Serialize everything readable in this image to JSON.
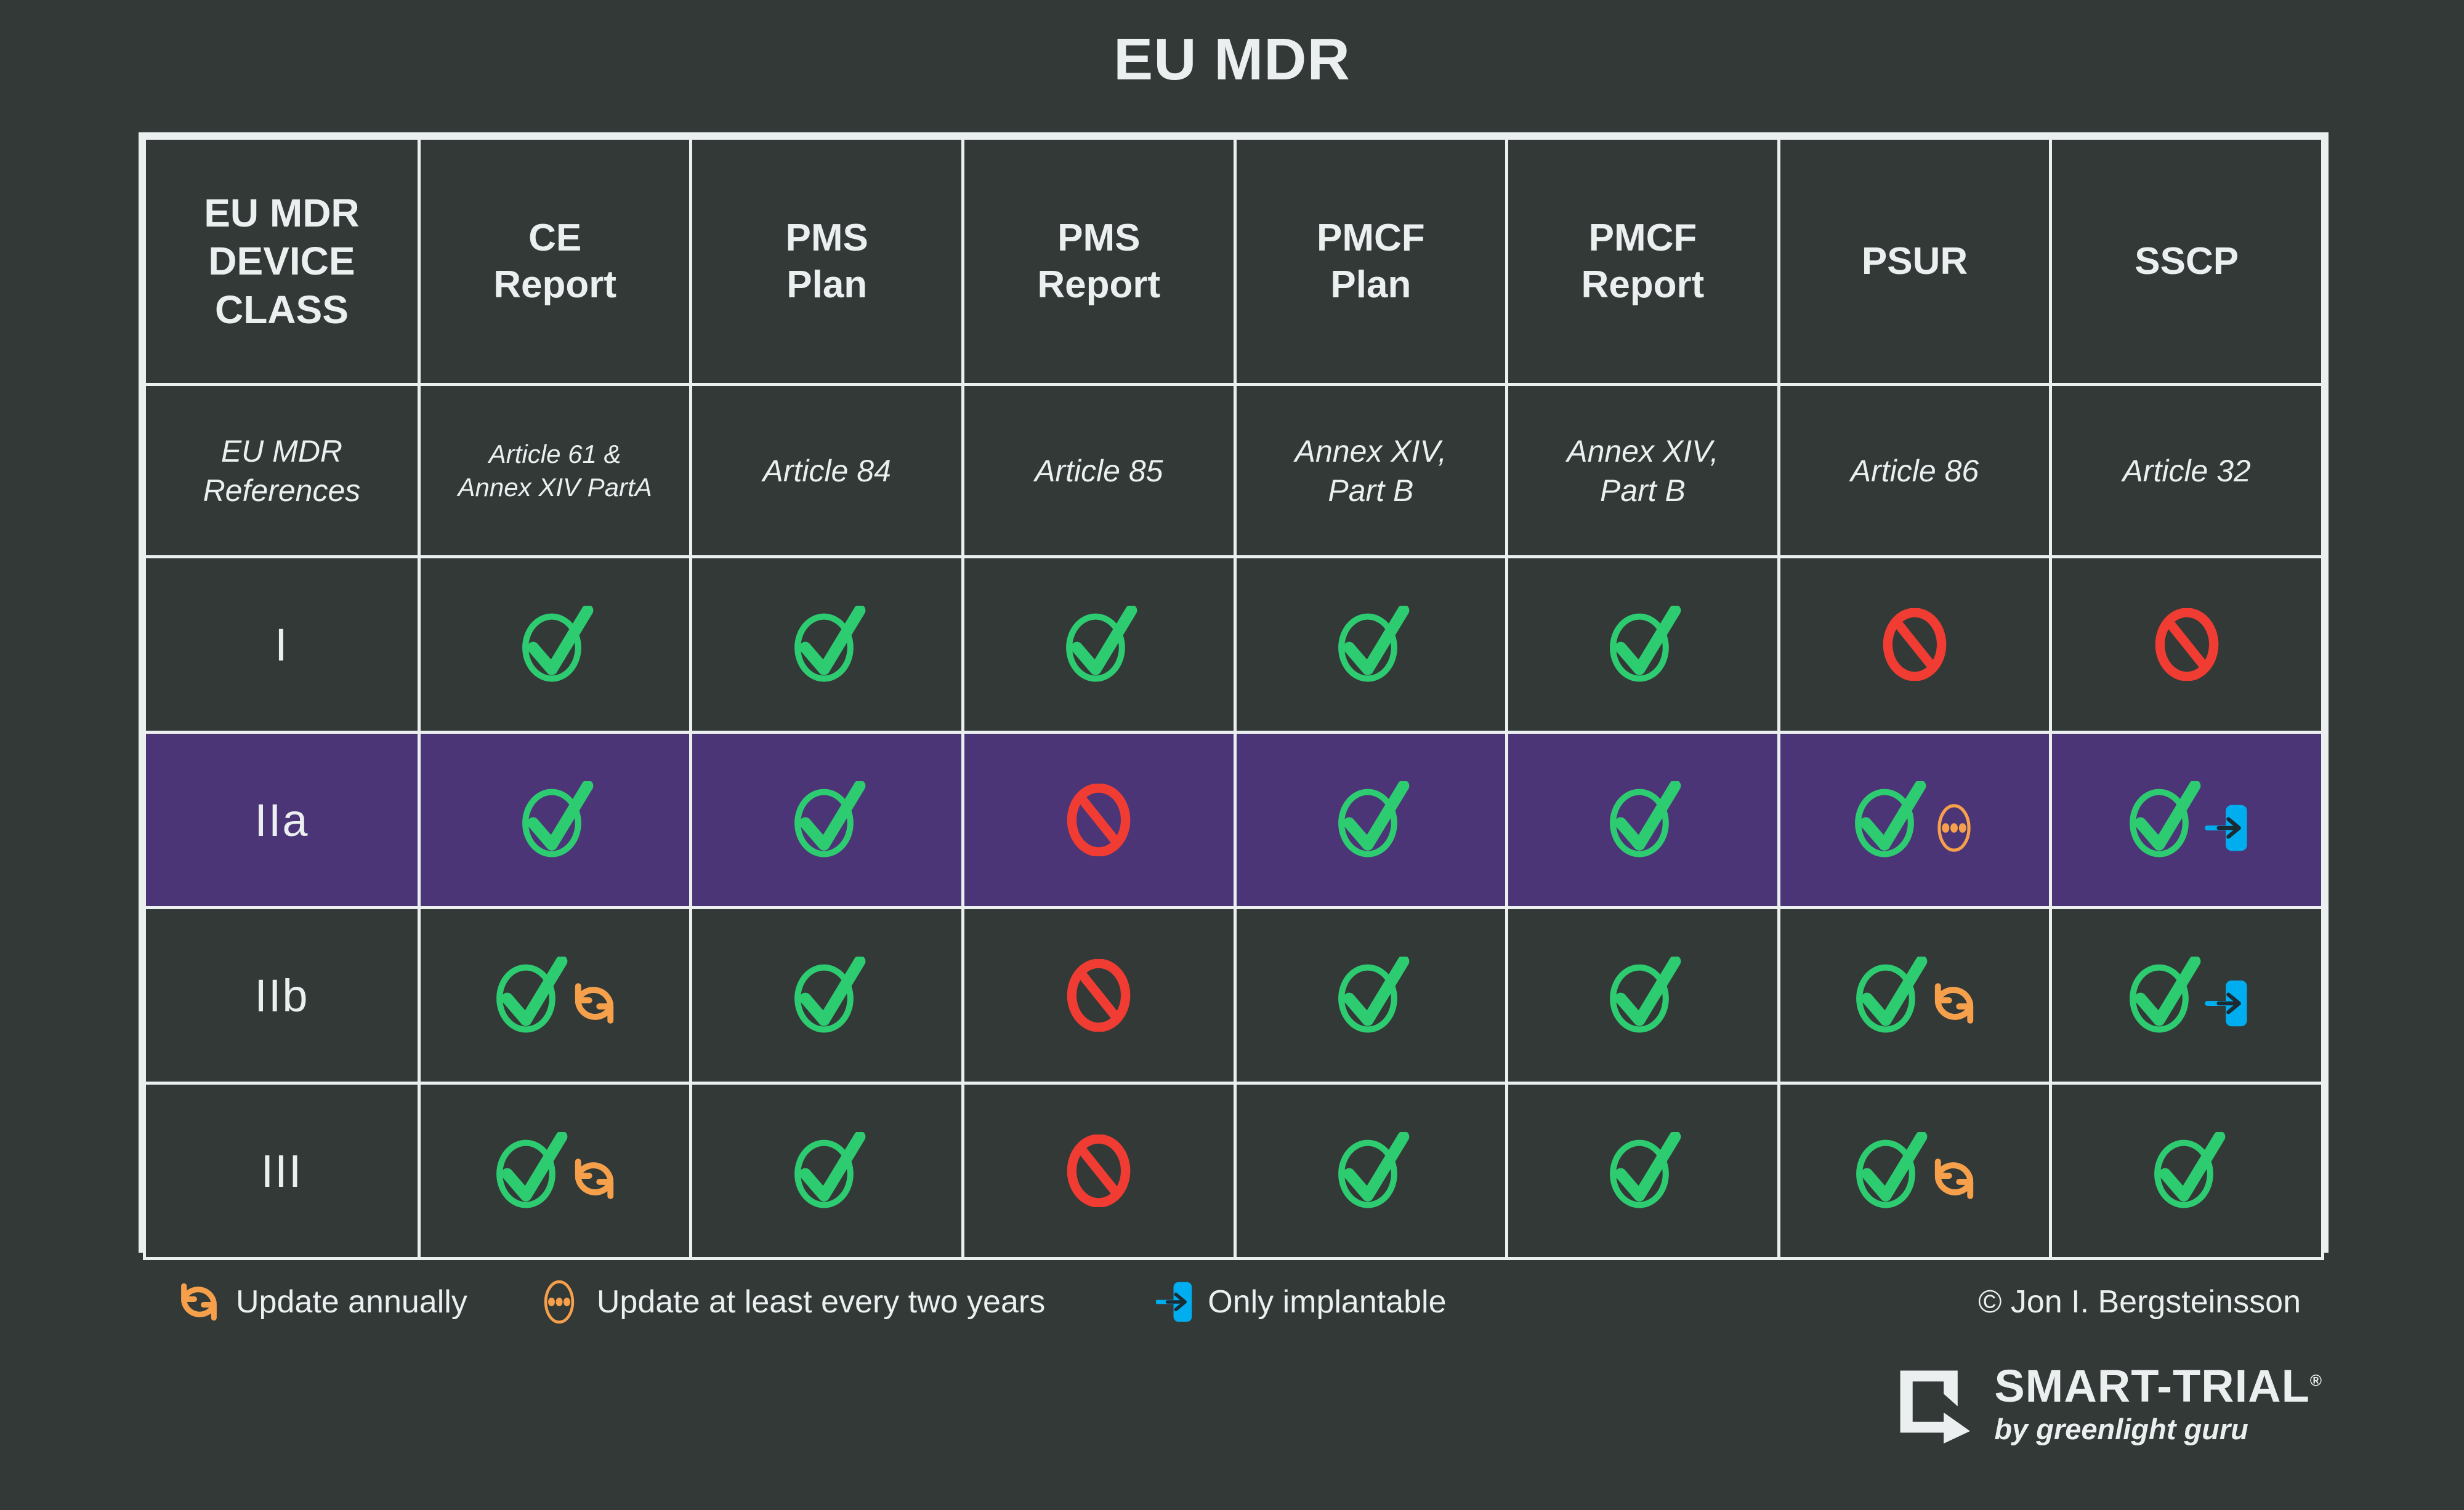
{
  "title": "EU MDR",
  "colors": {
    "background": "#323937",
    "grid": "#eceff0",
    "text": "#eceff0",
    "highlight_row": "#4b3576",
    "check_green": "#2ECC71",
    "deny_red": "#F03C32",
    "annual_orange": "#F7A04B",
    "implant_blue": "#00ADEF"
  },
  "table": {
    "headers": [
      {
        "label": "EU MDR\nDEVICE\nCLASS",
        "name": "col-device-class"
      },
      {
        "label": "CE\nReport",
        "name": "col-ce-report"
      },
      {
        "label": "PMS\nPlan",
        "name": "col-pms-plan"
      },
      {
        "label": "PMS\nReport",
        "name": "col-pms-report"
      },
      {
        "label": "PMCF\nPlan",
        "name": "col-pmcf-plan"
      },
      {
        "label": "PMCF\nReport",
        "name": "col-pmcf-report"
      },
      {
        "label": "PSUR",
        "name": "col-psur"
      },
      {
        "label": "SSCP",
        "name": "col-sscp"
      }
    ],
    "references": [
      "EU MDR\nReferences",
      "Article 61 &\nAnnex XIV PartA",
      "Article 84",
      "Article 85",
      "Annex XIV,\nPart B",
      "Annex XIV,\nPart B",
      "Article 86",
      "Article 32"
    ],
    "rows": [
      {
        "class": "I",
        "highlight": false,
        "cells": [
          {
            "status": "yes",
            "badge": null
          },
          {
            "status": "yes",
            "badge": null
          },
          {
            "status": "yes",
            "badge": null
          },
          {
            "status": "yes",
            "badge": null
          },
          {
            "status": "yes",
            "badge": null
          },
          {
            "status": "no",
            "badge": null
          },
          {
            "status": "no",
            "badge": null
          }
        ]
      },
      {
        "class": "IIa",
        "highlight": true,
        "cells": [
          {
            "status": "yes",
            "badge": null
          },
          {
            "status": "yes",
            "badge": null
          },
          {
            "status": "no",
            "badge": null
          },
          {
            "status": "yes",
            "badge": null
          },
          {
            "status": "yes",
            "badge": null
          },
          {
            "status": "yes",
            "badge": "twoyear"
          },
          {
            "status": "yes",
            "badge": "implantable"
          }
        ]
      },
      {
        "class": "IIb",
        "highlight": false,
        "cells": [
          {
            "status": "yes",
            "badge": "annual"
          },
          {
            "status": "yes",
            "badge": null
          },
          {
            "status": "no",
            "badge": null
          },
          {
            "status": "yes",
            "badge": null
          },
          {
            "status": "yes",
            "badge": null
          },
          {
            "status": "yes",
            "badge": "annual"
          },
          {
            "status": "yes",
            "badge": "implantable"
          }
        ]
      },
      {
        "class": "III",
        "highlight": false,
        "cells": [
          {
            "status": "yes",
            "badge": "annual"
          },
          {
            "status": "yes",
            "badge": null
          },
          {
            "status": "no",
            "badge": null
          },
          {
            "status": "yes",
            "badge": null
          },
          {
            "status": "yes",
            "badge": null
          },
          {
            "status": "yes",
            "badge": "annual"
          },
          {
            "status": "yes",
            "badge": null
          }
        ]
      }
    ]
  },
  "legend": {
    "items": [
      {
        "icon": "refresh-annual-icon",
        "label": "Update annually"
      },
      {
        "icon": "dots-circle-icon",
        "label": "Update at least every two years"
      },
      {
        "icon": "implantable-arrow-icon",
        "label": "Only implantable"
      }
    ],
    "copyright": "© Jon I. Bergsteinsson"
  },
  "brand": {
    "name": "SMART-TRIAL",
    "registered": "®",
    "tagline": "by greenlight guru"
  }
}
